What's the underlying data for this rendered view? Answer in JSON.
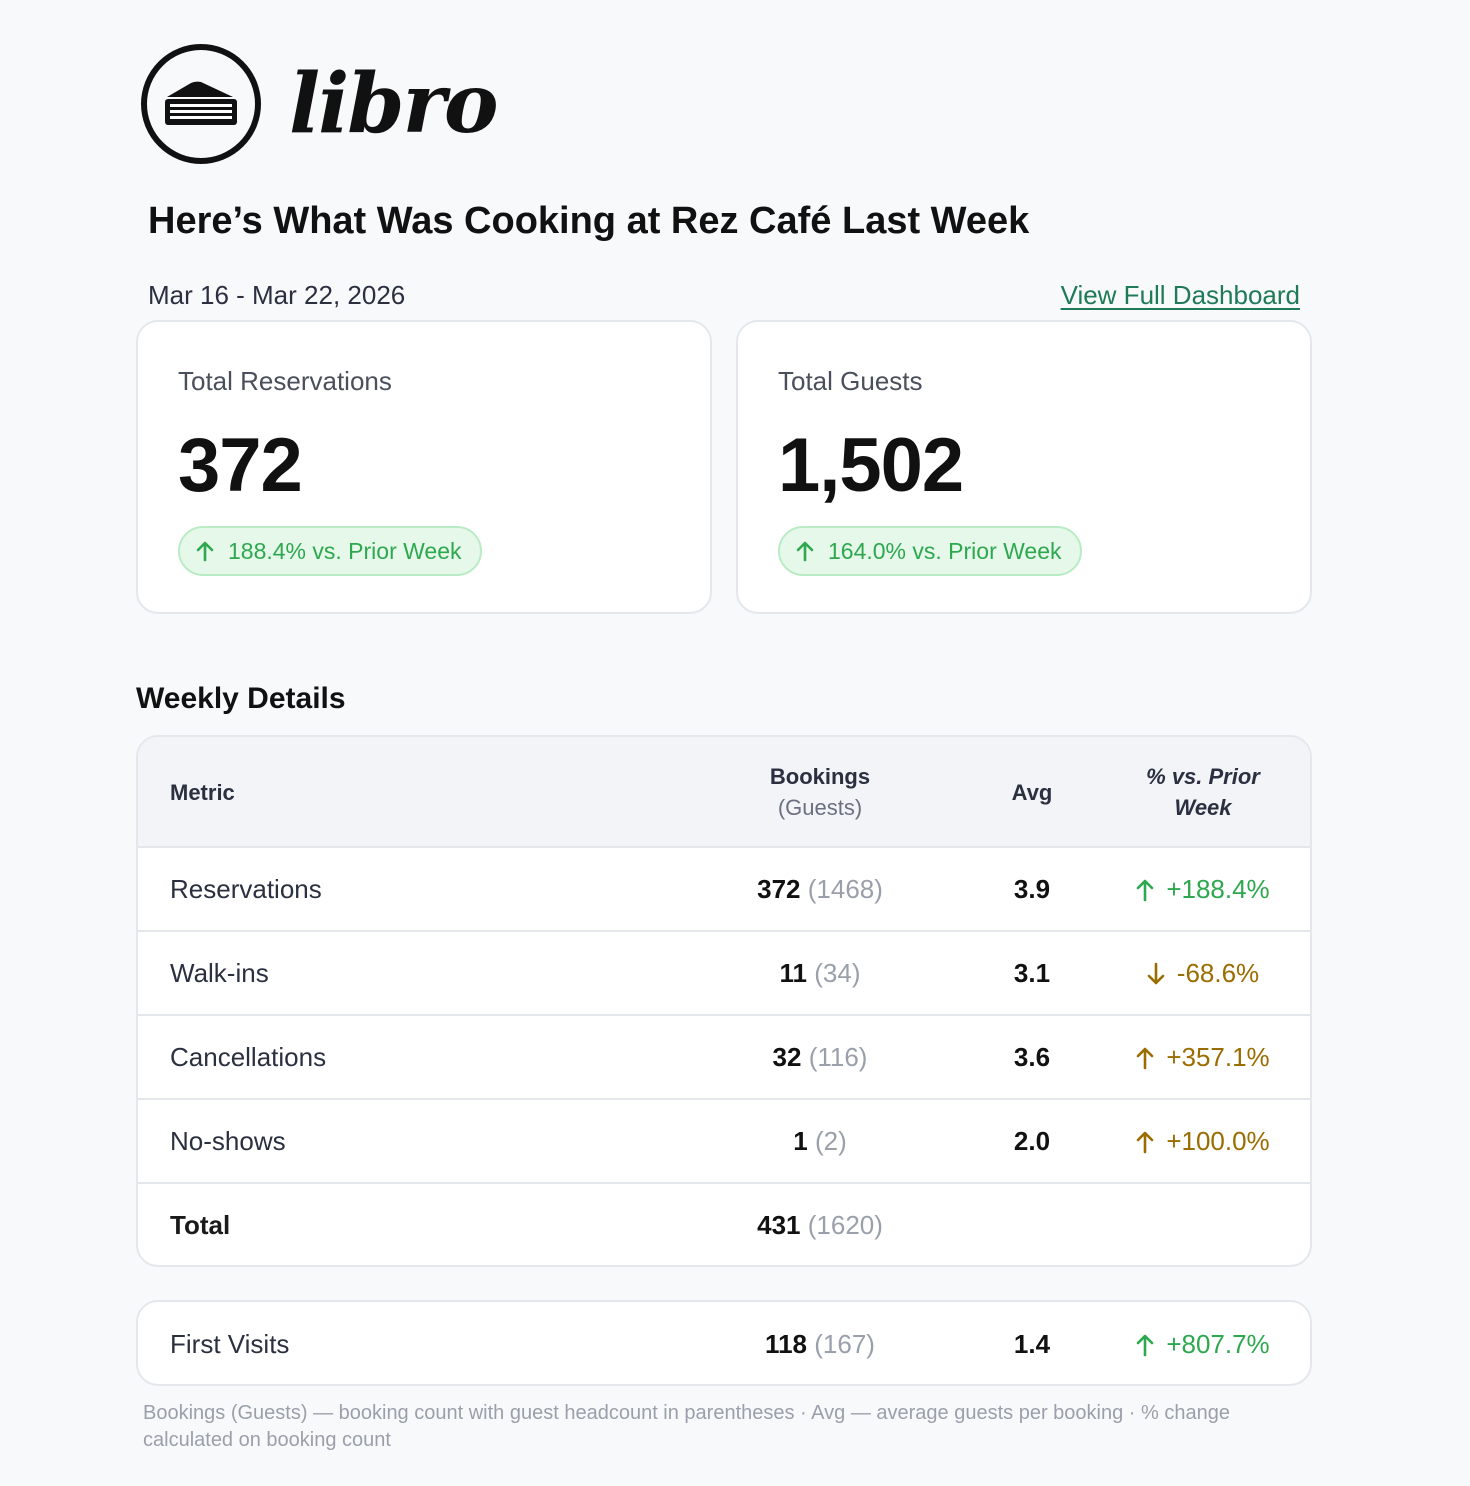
{
  "brand": {
    "name": "libro"
  },
  "header": {
    "headline": "Here’s What Was Cooking at Rez Café Last Week",
    "date_range": "Mar 16 - Mar 22, 2026",
    "dashboard_link": "View Full Dashboard"
  },
  "kpis": [
    {
      "label": "Total Reservations",
      "value": "372",
      "change": "188.4% vs. Prior Week"
    },
    {
      "label": "Total Guests",
      "value": "1,502",
      "change": "164.0% vs. Prior Week"
    }
  ],
  "details": {
    "title": "Weekly Details",
    "columns": {
      "metric": "Metric",
      "bookings": "Bookings",
      "bookings_sub": "(Guests)",
      "avg": "Avg",
      "pct": "% vs. Prior Week"
    },
    "rows": [
      {
        "name": "Reservations",
        "bookings": "372",
        "guests": "(1468)",
        "avg": "3.9",
        "pct": "+188.4%",
        "direction": "up",
        "tone": "good"
      },
      {
        "name": "Walk-ins",
        "bookings": "11",
        "guests": "(34)",
        "avg": "3.1",
        "pct": "-68.6%",
        "direction": "down",
        "tone": "warn"
      },
      {
        "name": "Cancellations",
        "bookings": "32",
        "guests": "(116)",
        "avg": "3.6",
        "pct": "+357.1%",
        "direction": "up",
        "tone": "warn"
      },
      {
        "name": "No-shows",
        "bookings": "1",
        "guests": "(2)",
        "avg": "2.0",
        "pct": "+100.0%",
        "direction": "up",
        "tone": "warn"
      }
    ],
    "total": {
      "name": "Total",
      "bookings": "431",
      "guests": "(1620)"
    }
  },
  "first_visits": {
    "name": "First Visits",
    "bookings": "118",
    "guests": "(167)",
    "avg": "1.4",
    "pct": "+807.7%",
    "direction": "up",
    "tone": "good"
  },
  "footnote": "Bookings (Guests) — booking count with guest headcount in parentheses · Avg — average guests per booking · % change calculated on booking count",
  "colors": {
    "good": "#2ea84f",
    "warn": "#9b6c00",
    "link": "#1f7a57"
  }
}
